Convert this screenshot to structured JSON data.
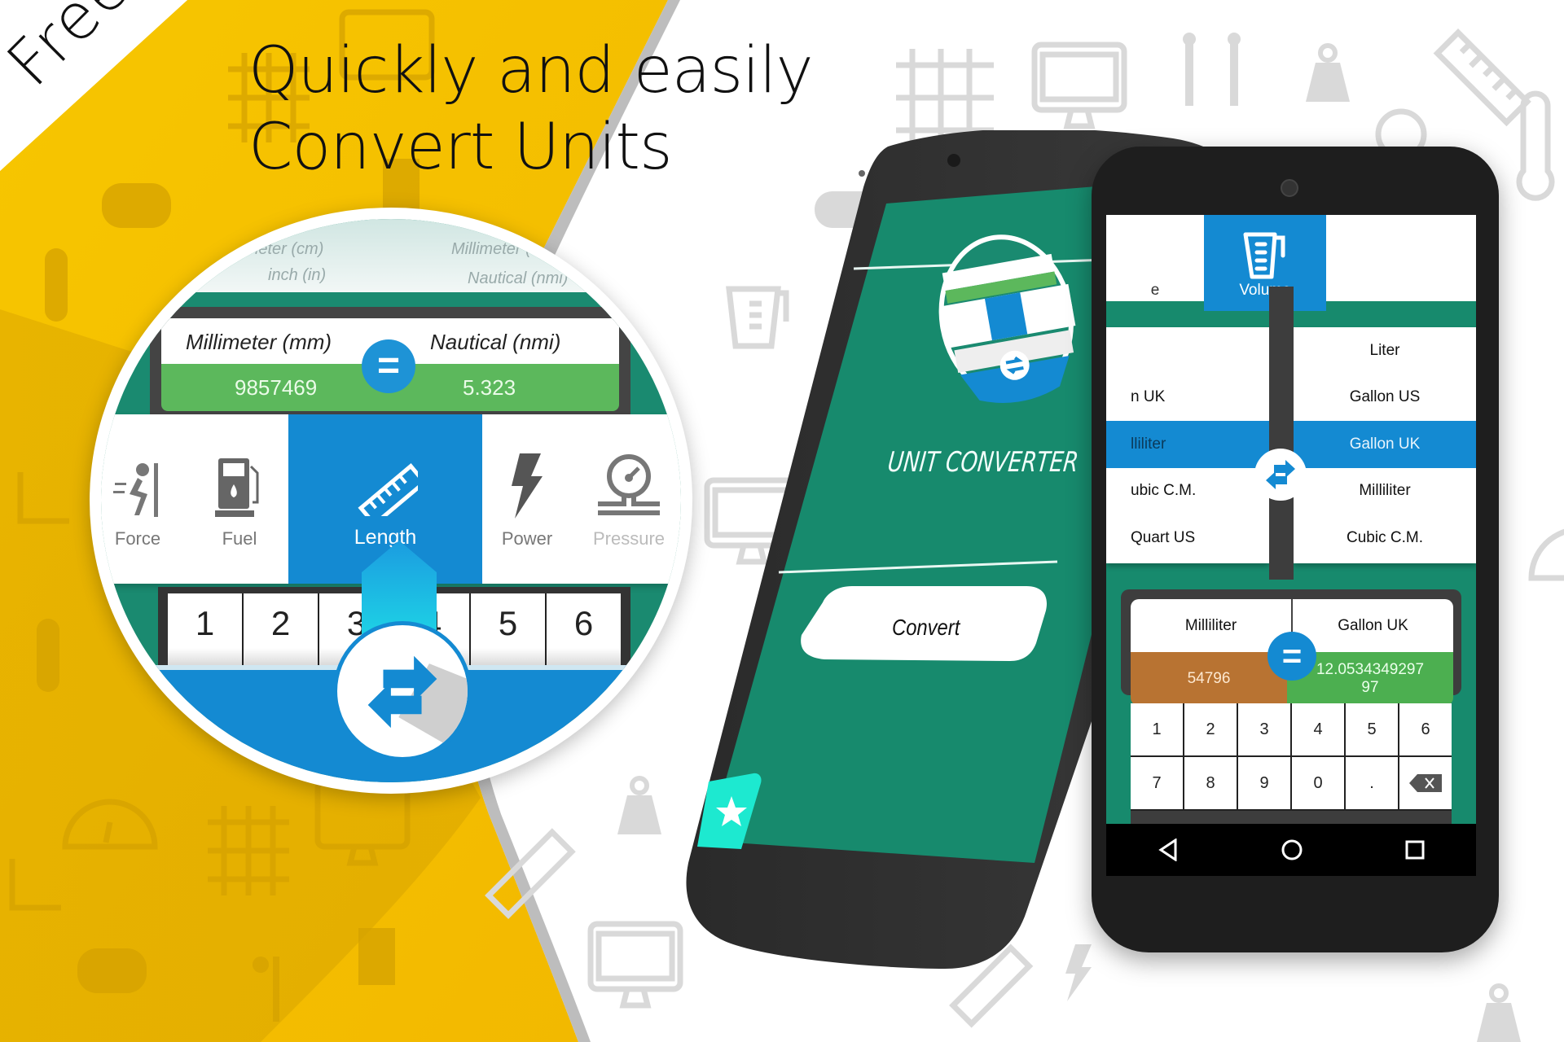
{
  "banner": {
    "ribbon_label": "Free",
    "headline_line1": "Quickly and easily",
    "headline_line2": "Convert Units",
    "colors": {
      "yellow": "#f5c000",
      "teal": "#178a6d",
      "blue": "#148ad2",
      "green": "#4caf50",
      "orange": "#b87332",
      "bg_icon_gray": "#d9d9d9"
    }
  },
  "magnifier": {
    "ghost_units": {
      "left_top": "Centimeter (cm)",
      "left_bottom": "inch (in)",
      "right_top": "Millimeter (mm)",
      "right_bottom": "Nautical (nmi)"
    },
    "conversion": {
      "from_unit": "Millimeter (mm)",
      "to_unit": "Nautical (nmi)",
      "from_value": "9857469",
      "to_value": "5.323",
      "equals_symbol": "="
    },
    "categories": [
      {
        "label": "Force",
        "icon": "force-icon",
        "active": false
      },
      {
        "label": "Fuel",
        "icon": "fuel-pump-icon",
        "active": false
      },
      {
        "label": "Length",
        "icon": "ruler-icon",
        "active": true
      },
      {
        "label": "Power",
        "icon": "lightning-icon",
        "active": false
      },
      {
        "label": "Pressure",
        "icon": "pressure-gauge-icon",
        "active": false
      }
    ],
    "keys": [
      "1",
      "2",
      "3",
      "4",
      "5",
      "6"
    ]
  },
  "middle_phone": {
    "app_title": "UNIT CONVERTER",
    "convert_button": "Convert",
    "favorites_icon": "star-icon",
    "add_icon": "plus-icon"
  },
  "right_phone": {
    "tabs": [
      {
        "label": "Time",
        "visible_label": "e",
        "active": false
      },
      {
        "label": "Volume",
        "icon": "measuring-cup-icon",
        "active": true
      },
      {
        "label": "",
        "active": false
      }
    ],
    "from_list": [
      "Gallon UK",
      "Milliliter",
      "Cubic C.M.",
      "Quart US"
    ],
    "from_list_visible": [
      "",
      "n UK",
      "lliliter",
      "ubic C.M.",
      "Quart US"
    ],
    "from_selected_index": 2,
    "to_list": [
      "Liter",
      "Gallon US",
      "Gallon UK",
      "Milliliter",
      "Cubic C.M."
    ],
    "to_selected_index": 2,
    "conversion": {
      "from_unit": "Milliliter",
      "to_unit": "Gallon UK",
      "from_value": "54796",
      "to_value": "12.0534349297\n97",
      "to_value_line1": "12.0534349297",
      "to_value_line2": "97",
      "equals_symbol": "="
    },
    "keypad": [
      [
        "1",
        "2",
        "3",
        "4",
        "5",
        "6"
      ],
      [
        "7",
        "8",
        "9",
        "0",
        ".",
        "backspace"
      ]
    ],
    "nav": [
      "back-icon",
      "home-icon",
      "recents-icon"
    ]
  }
}
